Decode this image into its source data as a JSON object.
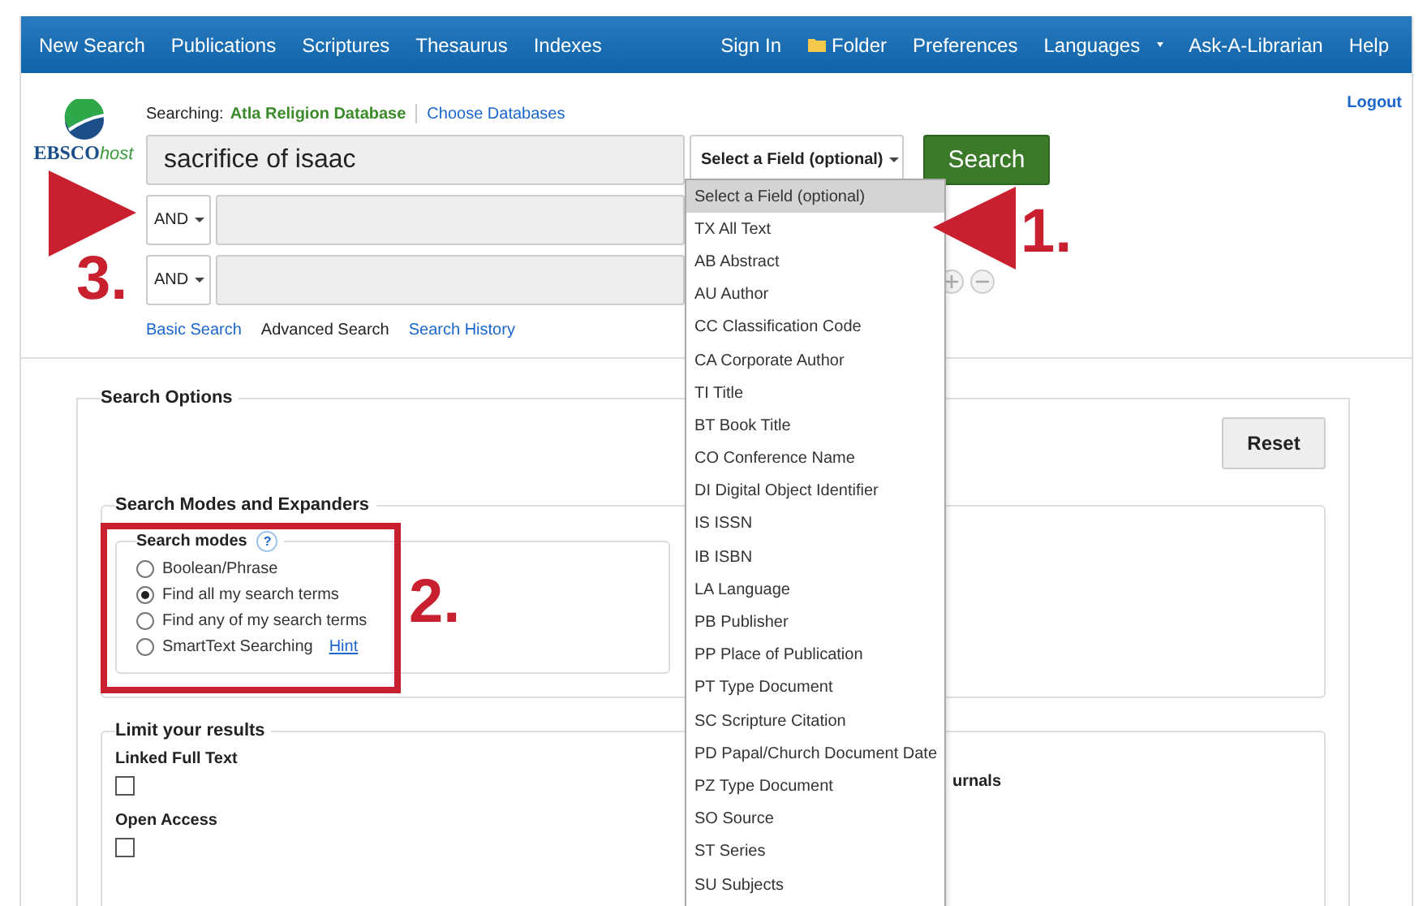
{
  "nav": {
    "left": [
      {
        "label": "New Search"
      },
      {
        "label": "Publications"
      },
      {
        "label": "Scriptures"
      },
      {
        "label": "Thesaurus"
      },
      {
        "label": "Indexes"
      }
    ],
    "right": [
      {
        "label": "Sign In",
        "kind": "link"
      },
      {
        "label": "Folder",
        "kind": "folder"
      },
      {
        "label": "Preferences",
        "kind": "link"
      },
      {
        "label": "Languages",
        "kind": "menu"
      },
      {
        "label": "Ask-A-Librarian",
        "kind": "link"
      },
      {
        "label": "Help",
        "kind": "link"
      }
    ]
  },
  "logo": {
    "text": "EBSCO",
    "suffix": "host"
  },
  "search": {
    "searching_label": "Searching:",
    "database": "Atla Religion Database",
    "choose_link": "Choose Databases",
    "query": "sacrifice of isaac",
    "field_select": "Select a Field (optional)",
    "search_button": "Search",
    "extra_rows": [
      {
        "operator": "AND"
      },
      {
        "operator": "AND"
      }
    ],
    "links": [
      {
        "label": "Basic Search",
        "selected": false
      },
      {
        "label": "Advanced Search",
        "selected": true
      },
      {
        "label": "Search History",
        "selected": false
      }
    ],
    "logout": "Logout"
  },
  "field_dropdown": {
    "items": [
      {
        "label": "Select a Field (optional)",
        "selected": true
      },
      {
        "label": "TX All Text",
        "selected": false
      },
      {
        "label": "AB Abstract",
        "selected": false
      },
      {
        "label": "AU Author",
        "selected": false
      },
      {
        "label": "CC Classification Code",
        "selected": false
      },
      {
        "label": "CA Corporate Author",
        "selected": false
      },
      {
        "label": "TI Title",
        "selected": false
      },
      {
        "label": "BT Book Title",
        "selected": false
      },
      {
        "label": "CO Conference Name",
        "selected": false
      },
      {
        "label": "DI Digital Object Identifier",
        "selected": false
      },
      {
        "label": "IS ISSN",
        "selected": false
      },
      {
        "label": "IB ISBN",
        "selected": false
      },
      {
        "label": "LA Language",
        "selected": false
      },
      {
        "label": "PB Publisher",
        "selected": false
      },
      {
        "label": "PP Place of Publication",
        "selected": false
      },
      {
        "label": "PT Type Document",
        "selected": false
      },
      {
        "label": "SC Scripture Citation",
        "selected": false
      },
      {
        "label": "PD Papal/Church Document Date",
        "selected": false
      },
      {
        "label": "PZ Type Document",
        "selected": false
      },
      {
        "label": "SO Source",
        "selected": false
      },
      {
        "label": "ST Series",
        "selected": false
      },
      {
        "label": "SU Subjects",
        "selected": false
      }
    ]
  },
  "search_options": {
    "title": "Search Options",
    "reset": "Reset",
    "modes_and_expanders": {
      "title": "Search Modes and Expanders",
      "search_modes": {
        "title": "Search modes",
        "help": "?",
        "options": [
          {
            "label": "Boolean/Phrase",
            "selected": false
          },
          {
            "label": "Find all my search terms",
            "selected": true
          },
          {
            "label": "Find any of my search terms",
            "selected": false
          },
          {
            "label": "SmartText Searching",
            "selected": false,
            "hint": "Hint"
          }
        ]
      }
    },
    "limit": {
      "title": "Limit your results",
      "items": [
        {
          "label": "Linked Full Text",
          "checked": false
        },
        {
          "label": "Open Access",
          "checked": false
        }
      ],
      "column_2_label": "urnals"
    }
  },
  "annotations": [
    {
      "kind": "arrow-left",
      "label": "1."
    },
    {
      "kind": "box",
      "label": "2."
    },
    {
      "kind": "arrow-right",
      "label": "3."
    }
  ]
}
